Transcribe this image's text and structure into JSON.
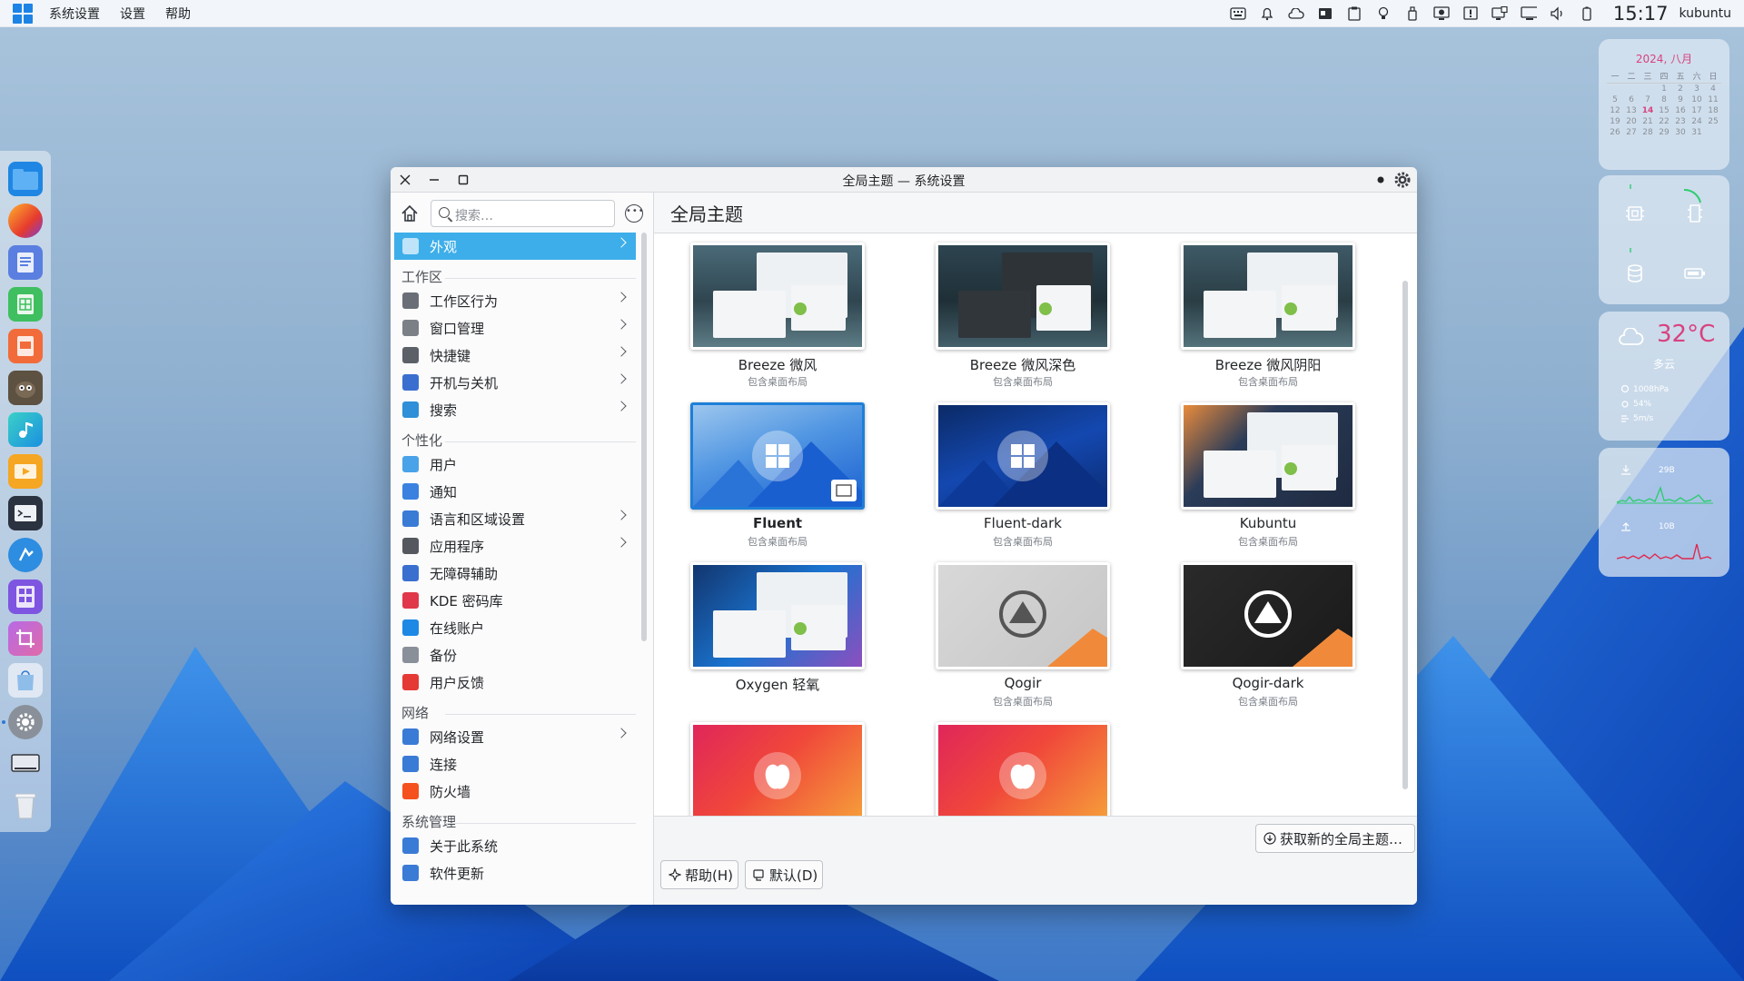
{
  "topbar": {
    "menu": [
      "系统设置",
      "设置",
      "帮助"
    ],
    "clock": "15:17",
    "user": "kubuntu",
    "tray_icons": [
      "keyboard-icon",
      "bell-icon",
      "cloud-icon",
      "screenshot-icon",
      "clipboard-icon",
      "lightbulb-icon",
      "usb-icon",
      "display-icon",
      "update-icon",
      "monitor-icon",
      "network-icon",
      "volume-icon",
      "battery-icon"
    ]
  },
  "dock": {
    "apps": [
      "file-manager-icon",
      "firefox-icon",
      "writer-icon",
      "calc-icon",
      "impress-icon",
      "gimp-icon",
      "music-icon",
      "video-player-icon",
      "terminal-icon",
      "app-launcher-icon",
      "kcalc-icon",
      "crop-tool-icon",
      "store-icon",
      "settings-icon",
      "monitor-icon",
      "trash-icon"
    ]
  },
  "calendar": {
    "title": "2024, 八月",
    "weekdays": [
      "一",
      "二",
      "三",
      "四",
      "五",
      "六",
      "日"
    ],
    "days": [
      "",
      "",
      "",
      "1",
      "2",
      "3",
      "4",
      "5",
      "6",
      "7",
      "8",
      "9",
      "10",
      "11",
      "12",
      "13",
      "14",
      "15",
      "16",
      "17",
      "18",
      "19",
      "20",
      "21",
      "22",
      "23",
      "24",
      "25",
      "26",
      "27",
      "28",
      "29",
      "30",
      "31",
      ""
    ],
    "today": "14"
  },
  "weather": {
    "temp": "32°C",
    "desc": "多云",
    "pressure": "1008hPa",
    "humidity": "54%",
    "wind": "5m/s"
  },
  "network": {
    "down": "29B",
    "up": "10B"
  },
  "window": {
    "title": "全局主题 — 系统设置",
    "search_placeholder": "搜索…",
    "page_title": "全局主题",
    "sidebar": {
      "selected": "外观",
      "sections": [
        {
          "header": "工作区",
          "items": [
            {
              "label": "工作区行为",
              "chev": true
            },
            {
              "label": "窗口管理",
              "chev": true
            },
            {
              "label": "快捷键",
              "chev": true
            },
            {
              "label": "开机与关机",
              "chev": true
            },
            {
              "label": "搜索",
              "chev": true
            }
          ]
        },
        {
          "header": "个性化",
          "items": [
            {
              "label": "用户",
              "chev": false
            },
            {
              "label": "通知",
              "chev": false
            },
            {
              "label": "语言和区域设置",
              "chev": true
            },
            {
              "label": "应用程序",
              "chev": true
            },
            {
              "label": "无障碍辅助",
              "chev": false
            },
            {
              "label": "KDE 密码库",
              "chev": false
            },
            {
              "label": "在线账户",
              "chev": false
            },
            {
              "label": "备份",
              "chev": false
            },
            {
              "label": "用户反馈",
              "chev": false
            }
          ]
        },
        {
          "header": "网络",
          "items": [
            {
              "label": "网络设置",
              "chev": true
            },
            {
              "label": "连接",
              "chev": false
            },
            {
              "label": "防火墙",
              "chev": false
            }
          ]
        },
        {
          "header": "系统管理",
          "items": [
            {
              "label": "关于此系统",
              "chev": false
            },
            {
              "label": "软件更新",
              "chev": false
            }
          ]
        }
      ]
    },
    "themes": [
      {
        "name": "Breeze 微风",
        "sub": "包含桌面布局",
        "selected": false
      },
      {
        "name": "Breeze 微风深色",
        "sub": "包含桌面布局",
        "selected": false
      },
      {
        "name": "Breeze 微风阴阳",
        "sub": "包含桌面布局",
        "selected": false
      },
      {
        "name": "Fluent",
        "sub": "包含桌面布局",
        "selected": true
      },
      {
        "name": "Fluent-dark",
        "sub": "包含桌面布局",
        "selected": false
      },
      {
        "name": "Kubuntu",
        "sub": "包含桌面布局",
        "selected": false
      },
      {
        "name": "Oxygen 轻氧",
        "sub": "",
        "selected": false
      },
      {
        "name": "Qogir",
        "sub": "包含桌面布局",
        "selected": false
      },
      {
        "name": "Qogir-dark",
        "sub": "包含桌面布局",
        "selected": false
      },
      {
        "name": "",
        "sub": "",
        "selected": false
      },
      {
        "name": "",
        "sub": "",
        "selected": false
      }
    ],
    "get_new_button": "获取新的全局主题…",
    "help_button": "帮助(H)",
    "defaults_button": "默认(D)"
  },
  "colors": {
    "accent": "#3daee9",
    "selection_border": "#1e7fd8",
    "pink": "#d94280"
  }
}
